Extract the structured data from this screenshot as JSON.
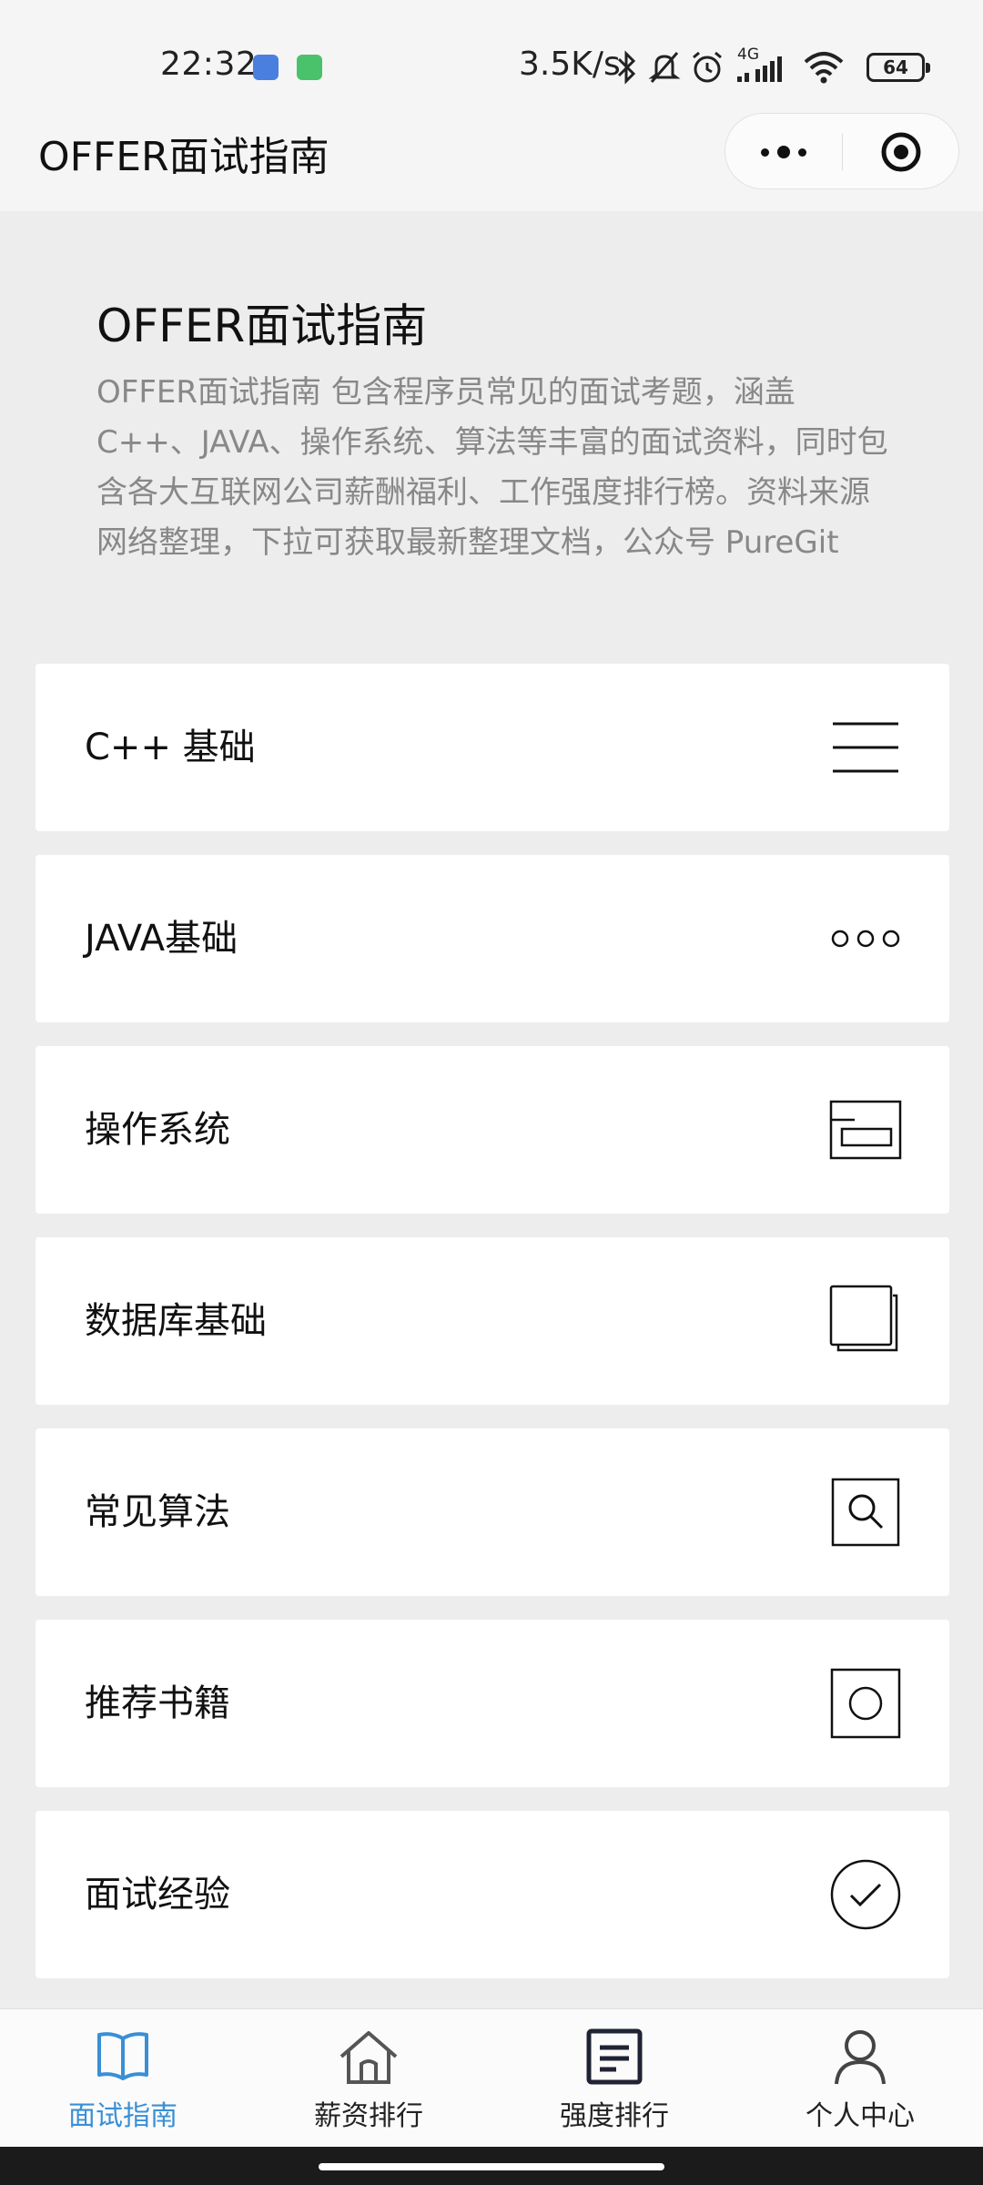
{
  "status_bar": {
    "time": "22:32",
    "network_speed": "3.5K/s",
    "network_type": "4G",
    "battery": "64",
    "icons": [
      "bluetooth-icon",
      "mute-icon",
      "alarm-icon",
      "signal-icon",
      "wifi-icon"
    ]
  },
  "nav": {
    "title": "OFFER面试指南"
  },
  "intro": {
    "title": "OFFER面试指南",
    "description": "OFFER面试指南 包含程序员常见的面试考题，涵盖C++、JAVA、操作系统、算法等丰富的面试资料，同时包含各大互联网公司薪酬福利、工作强度排行榜。资料来源网络整理，下拉可获取最新整理文档，公众号 PureGit"
  },
  "categories": [
    {
      "label": "C++ 基础",
      "icon": "menu-lines-icon"
    },
    {
      "label": "JAVA基础",
      "icon": "three-dots-icon"
    },
    {
      "label": "操作系统",
      "icon": "window-icon"
    },
    {
      "label": "数据库基础",
      "icon": "stacked-pages-icon"
    },
    {
      "label": "常见算法",
      "icon": "search-icon"
    },
    {
      "label": "推荐书籍",
      "icon": "circle-in-square-icon"
    },
    {
      "label": "面试经验",
      "icon": "check-circle-icon"
    }
  ],
  "tabs": [
    {
      "label": "面试指南",
      "icon": "book-icon",
      "active": true
    },
    {
      "label": "薪资排行",
      "icon": "home-icon",
      "active": false
    },
    {
      "label": "强度排行",
      "icon": "document-icon",
      "active": false
    },
    {
      "label": "个人中心",
      "icon": "person-icon",
      "active": false
    }
  ],
  "colors": {
    "accent": "#3a8fd6",
    "background": "#ededed",
    "card": "#ffffff",
    "muted_text": "#888888"
  }
}
